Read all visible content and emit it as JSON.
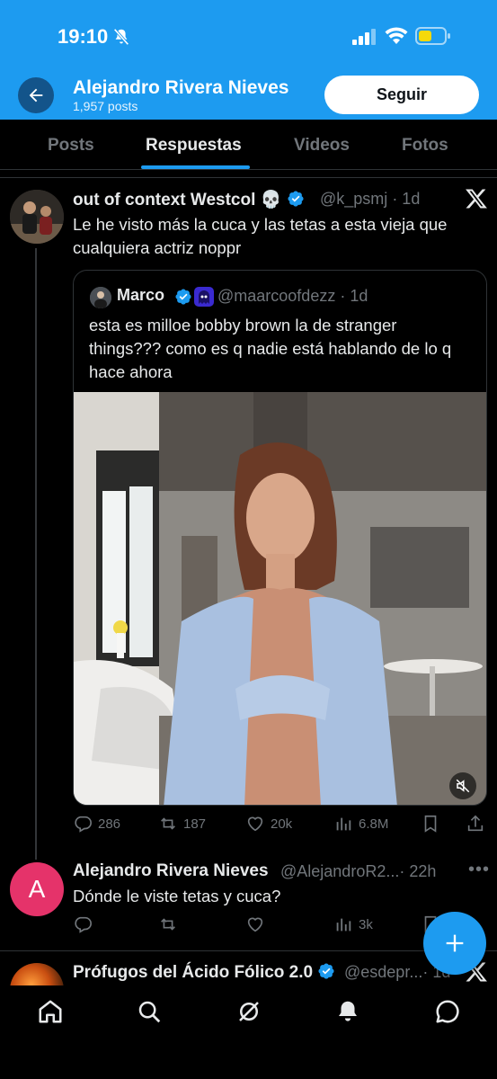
{
  "status_bar": {
    "time": "19:10",
    "icons": [
      "bell-off-icon",
      "cellular-signal-icon",
      "wifi-icon",
      "battery-icon"
    ],
    "battery_color": "#f5d90a"
  },
  "header": {
    "profile_name": "Alejandro Rivera Nieves",
    "post_count": "1,957 posts",
    "follow_label": "Seguir",
    "bg_color": "#1d9bf0"
  },
  "tabs": [
    {
      "label": "Posts",
      "active": false
    },
    {
      "label": "Respuestas",
      "active": true
    },
    {
      "label": "Videos",
      "active": false
    },
    {
      "label": "Fotos",
      "active": false
    }
  ],
  "tweets": [
    {
      "name": "out of context Westcol 💀",
      "handle": "@k_psmj",
      "time": "· 1d",
      "verified": true,
      "text": "Le he visto más la cuca y las tetas a esta vieja que cualquiera actriz noppr",
      "quote": {
        "name": "Marco",
        "handle": "@maarcoofdezz",
        "time": "· 1d",
        "verified": true,
        "text": "esta es milloe bobby brown la de stranger things??? como es q nadie está hablando de lo q hace ahora",
        "media": "video"
      },
      "stats": {
        "replies": "286",
        "reposts": "187",
        "likes": "20k",
        "views": "6.8M"
      }
    },
    {
      "name": "Alejandro Rivera Nieves",
      "handle": "@AlejandroR2...",
      "time": "· 22h",
      "avatar_letter": "A",
      "avatar_color": "#e5336a",
      "text": "Dónde le viste tetas y cuca?",
      "stats": {
        "replies": "",
        "reposts": "",
        "likes": "",
        "views": "3k"
      }
    },
    {
      "name": "Prófugos del Ácido Fólico 2.0",
      "handle": "@esdepr...",
      "time": "· 1d",
      "verified": true
    }
  ],
  "bottom_nav": [
    "home-icon",
    "search-icon",
    "grok-icon",
    "notifications-icon",
    "messages-icon"
  ],
  "fab_icon": "plus-icon"
}
